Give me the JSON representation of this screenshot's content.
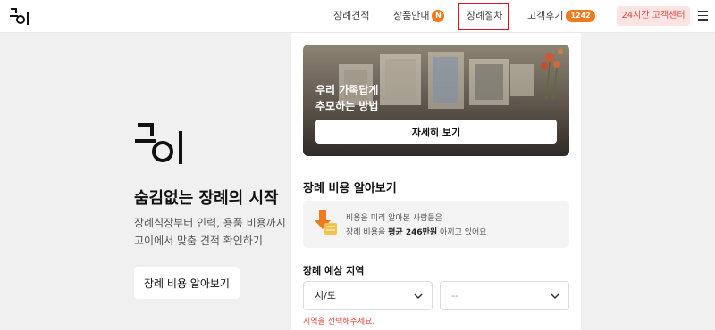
{
  "header": {
    "logo_alt": "고이",
    "nav": [
      {
        "label": "장례견적"
      },
      {
        "label": "상품안내",
        "badge": "N"
      },
      {
        "label": "장례절차"
      },
      {
        "label": "고객후기",
        "badge": "1242"
      }
    ],
    "cs_button": "24시간 고객센터"
  },
  "brand": {
    "title": "숨김없는 장례의 시작",
    "desc_line1": "장례식장부터 인력, 용품 비용까지",
    "desc_line2": "고이에서 맞춤 견적 확인하기",
    "cta": "장례 비용 알아보기"
  },
  "banner": {
    "title_line1": "우리 가족답게",
    "title_line2": "추모하는 방법",
    "button": "자세히 보기"
  },
  "cost_section": {
    "title": "장례 비용 알아보기",
    "info_line1": "비용을 미리 알아본 사람들은",
    "info_prefix": "장례 비용을 ",
    "info_bold": "평균 246만원",
    "info_suffix": " 아끼고 있어요"
  },
  "region": {
    "label": "장례 예상 지역",
    "select1": "시/도",
    "select2": "--",
    "error": "지역을 선택해주세요."
  },
  "colors": {
    "accent": "#f07a1e",
    "error": "#e4493c",
    "highlight": "#e0141c",
    "cs_bg": "#fde4e4"
  }
}
